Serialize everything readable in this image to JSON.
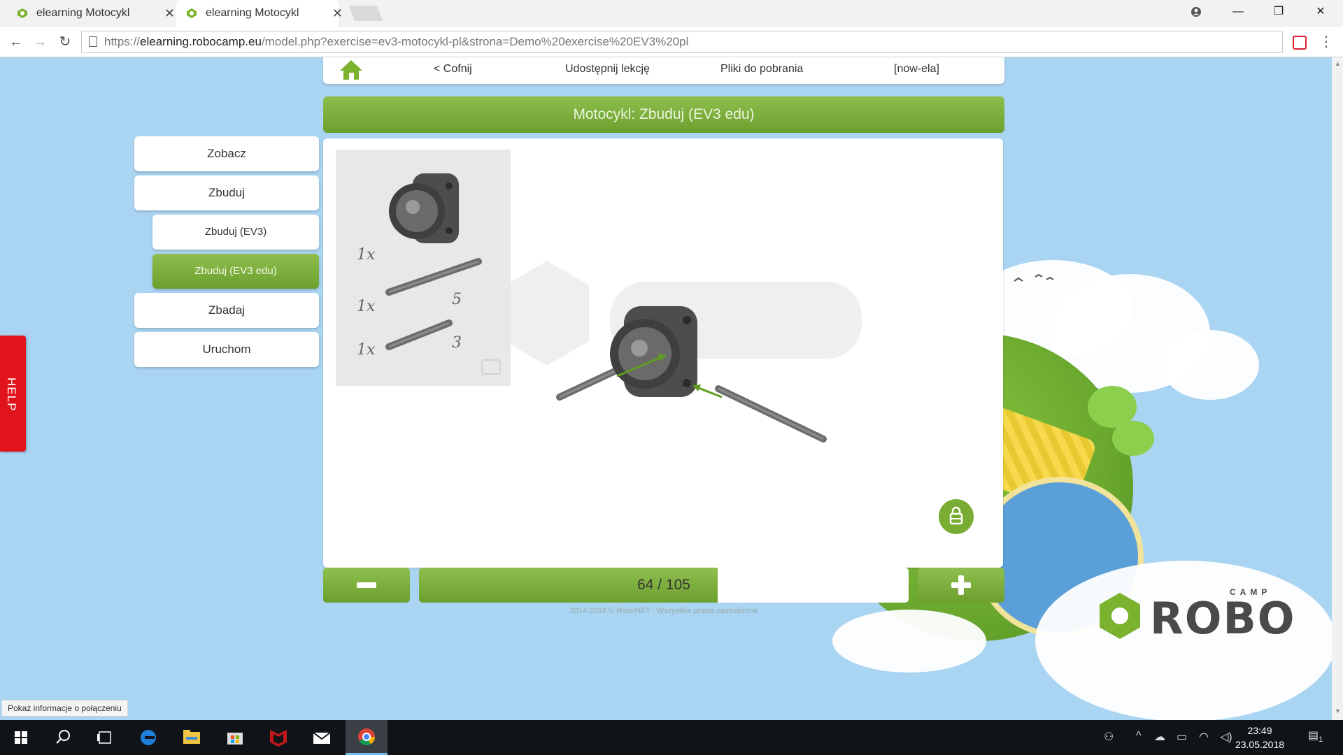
{
  "browser": {
    "tabs": [
      {
        "title": "elearning Motocykl",
        "active": false
      },
      {
        "title": "elearning Motocykl",
        "active": true
      }
    ],
    "url_scheme": "https://",
    "url_host": "elearning.robocamp.eu",
    "url_path": "/model.php?exercise=ev3-motocykl-pl&strona=Demo%20exercise%20EV3%20pl"
  },
  "nav": {
    "back": "< Cofnij",
    "share": "Udostępnij lekcję",
    "downloads": "Pliki do pobrania",
    "user": "[now-ela]"
  },
  "title": "Motocykl: Zbuduj (EV3 edu)",
  "sidebar": {
    "items": [
      {
        "label": "Zobacz"
      },
      {
        "label": "Zbuduj"
      },
      {
        "label": "Zbuduj (EV3)"
      },
      {
        "label": "Zbuduj (EV3 edu)"
      },
      {
        "label": "Zbadaj"
      },
      {
        "label": "Uruchom"
      }
    ]
  },
  "parts": [
    {
      "qty": "1x",
      "length": ""
    },
    {
      "qty": "1x",
      "length": "5"
    },
    {
      "qty": "1x",
      "length": "3"
    }
  ],
  "step": {
    "current": 64,
    "total": 105,
    "label": "64 / 105"
  },
  "footer": "2014-2016 © RoboNET : Wszystkie prawa zastrzeżone",
  "help": "HELP",
  "logo": {
    "word": "ROBO",
    "sub": "CAMP"
  },
  "status_bubble": "Pokaż informacje o połączeniu",
  "clock": {
    "time": "23:49",
    "date": "23.05.2018"
  },
  "notifications": "1",
  "colors": {
    "accent_green": "#7bb32e",
    "help_red": "#e2141b",
    "background_sky": "#a9d4f2"
  }
}
